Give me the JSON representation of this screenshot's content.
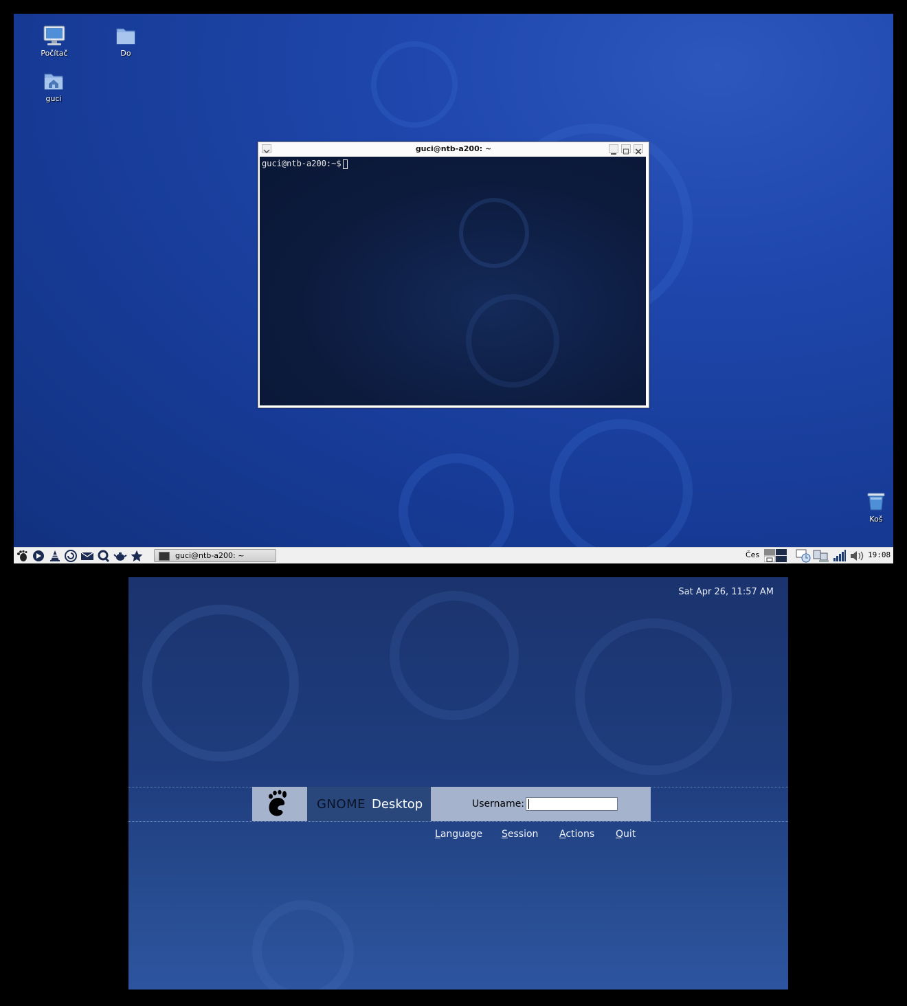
{
  "desktop": {
    "icons": [
      {
        "label": "Počítač",
        "icon": "computer-icon"
      },
      {
        "label": "Do",
        "icon": "folder-icon"
      },
      {
        "label": "guci",
        "icon": "home-folder-icon"
      },
      {
        "label": "Koš",
        "icon": "trash-icon"
      }
    ],
    "terminal": {
      "title": "guci@ntb-a200: ~",
      "prompt": "guci@ntb-a200:~$"
    },
    "taskbar": {
      "launchers": [
        "gnome-foot-icon",
        "media-player-icon",
        "vlc-cone-icon",
        "browser-icon",
        "mail-icon",
        "search-icon",
        "teapot-icon",
        "star-icon"
      ],
      "task": {
        "label": "guci@ntb-a200: ~",
        "icon": "terminal-icon"
      },
      "keyboard_layout": "Čes",
      "clock": "19:08"
    }
  },
  "login": {
    "datetime": "Sat Apr 26, 11:57 AM",
    "brand_part1": "GNOME",
    "brand_part2": "Desktop",
    "username_label": "Username:",
    "username_value": "",
    "menu": {
      "language": {
        "accel": "L",
        "rest": "anguage"
      },
      "session": {
        "accel": "S",
        "rest": "ession"
      },
      "actions": {
        "accel": "A",
        "rest": "ctions"
      },
      "quit": {
        "accel": "Q",
        "rest": "uit"
      }
    },
    "colors": {
      "panel": "#a6b3cd",
      "title_panel": "#2a477c"
    }
  }
}
